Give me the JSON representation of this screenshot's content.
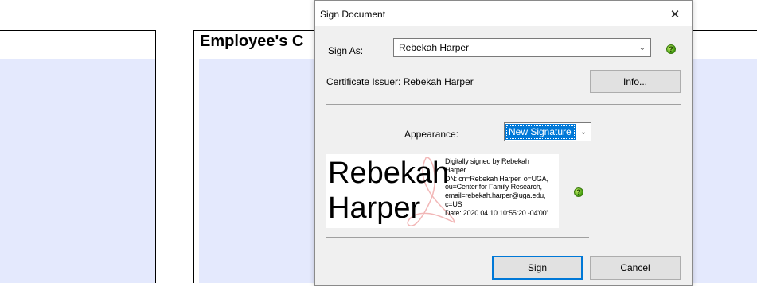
{
  "background": {
    "field_title": "Employee's C"
  },
  "dialog": {
    "title": "Sign Document",
    "close_glyph": "✕",
    "sign_as_label": "Sign As:",
    "sign_as_value": "Rebekah Harper",
    "certificate_issuer": "Certificate Issuer: Rebekah Harper",
    "info_button": "Info...",
    "appearance_label": "Appearance:",
    "appearance_value": "New Signature",
    "sign_button": "Sign",
    "cancel_button": "Cancel",
    "help_glyph": "?"
  },
  "preview": {
    "name_line1": "Rebekah",
    "name_line2": "Harper",
    "details": [
      "Digitally signed by Rebekah",
      "Harper",
      "DN: cn=Rebekah Harper, o=UGA,",
      "ou=Center for Family Research,",
      "email=rebekah.harper@uga.edu,",
      "c=US",
      "Date: 2020.04.10 10:55:20 -04'00'"
    ]
  },
  "colors": {
    "field_fill": "#e4e9fd",
    "selection": "#0078d7",
    "help_icon": "#3f9a0c"
  }
}
